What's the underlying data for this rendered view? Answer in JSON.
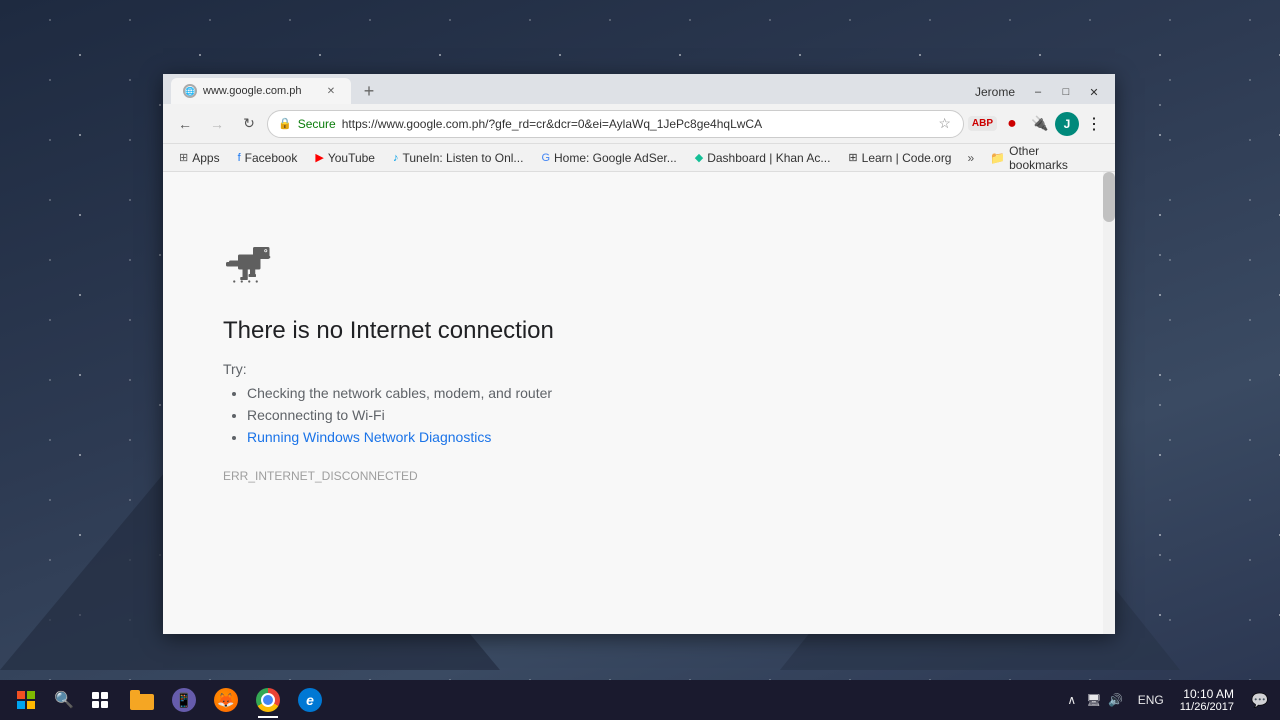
{
  "desktop": {
    "title": "Desktop"
  },
  "browser": {
    "title": "www.google.com.ph",
    "tab": {
      "label": "www.google.com.ph",
      "favicon": "globe"
    },
    "controls": {
      "minimize": "–",
      "maximize": "□",
      "close": "✕",
      "user": "Jerome"
    },
    "nav": {
      "back": "←",
      "forward": "→",
      "refresh": "↻",
      "secure_label": "Secure",
      "url": "https://www.google.com.ph/?gfe_rd=cr&dcr=0&ei=AylaWq_1JePc8ge4hqLwCA"
    },
    "bookmarks": [
      {
        "label": "Apps",
        "icon": "grid"
      },
      {
        "label": "Facebook",
        "icon": "fb"
      },
      {
        "label": "YouTube",
        "icon": "yt"
      },
      {
        "label": "TuneIn: Listen to Onl...",
        "icon": "tunein"
      },
      {
        "label": "Home: Google AdSer...",
        "icon": "google"
      },
      {
        "label": "Dashboard | Khan Ac...",
        "icon": "khan"
      },
      {
        "label": "Learn | Code.org",
        "icon": "code"
      }
    ],
    "other_bookmarks": "Other bookmarks",
    "more": "»"
  },
  "error_page": {
    "title": "There is no Internet connection",
    "try_label": "Try:",
    "suggestions": [
      "Checking the network cables, modem, and router",
      "Reconnecting to Wi-Fi",
      "Running Windows Network Diagnostics"
    ],
    "link_text": "Running Windows Network Diagnostics",
    "error_code": "ERR_INTERNET_DISCONNECTED"
  },
  "taskbar": {
    "time": "10:10 AM",
    "date": "11/26/2017",
    "language": "ENG",
    "apps": [
      {
        "name": "windows-start",
        "label": "Start"
      },
      {
        "name": "search",
        "label": "Search"
      },
      {
        "name": "task-view",
        "label": "Task View"
      },
      {
        "name": "file-explorer",
        "label": "File Explorer"
      },
      {
        "name": "viber",
        "label": "Viber"
      },
      {
        "name": "firefox",
        "label": "Firefox"
      },
      {
        "name": "chrome",
        "label": "Google Chrome",
        "active": true
      },
      {
        "name": "edge",
        "label": "Microsoft Edge"
      }
    ]
  }
}
